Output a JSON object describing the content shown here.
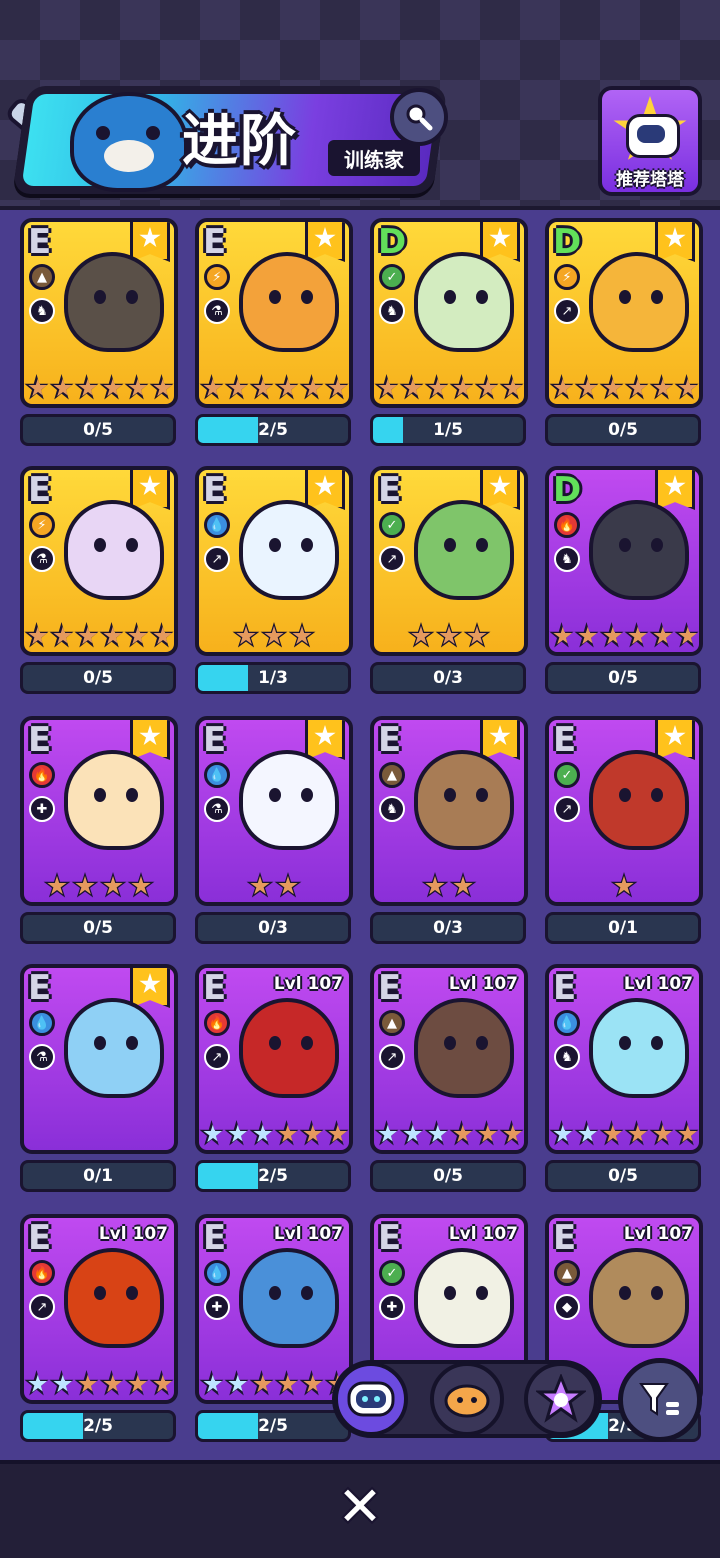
{
  "header": {
    "title": "进阶",
    "subtitle": "训练家",
    "recommend_label": "推荐塔塔"
  },
  "cards": [
    {
      "grade": "E",
      "grade_color": "#d4d4e6",
      "bg": "yellow",
      "type": "earth",
      "type_color": "#7a5a3a",
      "role": "foot",
      "badge": "star",
      "body": "#5a5048",
      "stars": [
        "b",
        "b",
        "b",
        "b",
        "b",
        "b"
      ],
      "progress": "0/5",
      "fill": 0
    },
    {
      "grade": "E",
      "grade_color": "#d4d4e6",
      "bg": "yellow",
      "type": "lightning",
      "type_color": "#f5a623",
      "role": "flask",
      "badge": "star",
      "body": "#f3a23a",
      "stars": [
        "b",
        "b",
        "b",
        "b",
        "b",
        "b"
      ],
      "progress": "2/5",
      "fill": 0.4
    },
    {
      "grade": "D",
      "grade_color": "#62e05a",
      "bg": "yellow",
      "type": "leaf",
      "type_color": "#4caf50",
      "role": "foot",
      "badge": "star",
      "body": "#d3ecc0",
      "stars": [
        "b",
        "b",
        "b",
        "b",
        "b",
        "b"
      ],
      "progress": "1/5",
      "fill": 0.2
    },
    {
      "grade": "D",
      "grade_color": "#62e05a",
      "bg": "yellow",
      "type": "lightning",
      "type_color": "#f5a623",
      "role": "run",
      "badge": "star",
      "body": "#f5b53a",
      "stars": [
        "b",
        "b",
        "b",
        "b",
        "b",
        "b"
      ],
      "progress": "0/5",
      "fill": 0
    },
    {
      "grade": "E",
      "grade_color": "#d4d4e6",
      "bg": "yellow",
      "type": "lightning",
      "type_color": "#f5a623",
      "role": "flask",
      "badge": "star",
      "body": "#e8d6f5",
      "stars": [
        "b",
        "b",
        "b",
        "b",
        "b",
        "b"
      ],
      "progress": "0/5",
      "fill": 0
    },
    {
      "grade": "E",
      "grade_color": "#d4d4e6",
      "bg": "yellow",
      "type": "water",
      "type_color": "#3b8fe0",
      "role": "run",
      "badge": "star",
      "body": "#eaf4ff",
      "stars": [
        "b",
        "b",
        "b"
      ],
      "progress": "1/3",
      "fill": 0.33
    },
    {
      "grade": "E",
      "grade_color": "#d4d4e6",
      "bg": "yellow",
      "type": "leaf",
      "type_color": "#4caf50",
      "role": "run",
      "badge": "star",
      "body": "#7fc56a",
      "stars": [
        "b",
        "b",
        "b"
      ],
      "progress": "0/3",
      "fill": 0
    },
    {
      "grade": "D",
      "grade_color": "#62e05a",
      "bg": "purple",
      "type": "fire",
      "type_color": "#e53935",
      "role": "foot",
      "badge": "star",
      "body": "#3a3a4a",
      "stars": [
        "b",
        "b",
        "b",
        "b",
        "b",
        "b"
      ],
      "progress": "0/5",
      "fill": 0
    },
    {
      "grade": "E",
      "grade_color": "#d4d4e6",
      "bg": "purple",
      "type": "fire",
      "type_color": "#e53935",
      "role": "plus",
      "badge": "star",
      "body": "#fbe2b8",
      "stars": [
        "b",
        "b",
        "b",
        "b"
      ],
      "progress": "0/5",
      "fill": 0
    },
    {
      "grade": "E",
      "grade_color": "#d4d4e6",
      "bg": "purple",
      "type": "water",
      "type_color": "#3b8fe0",
      "role": "flask",
      "badge": "star",
      "body": "#f4f6ff",
      "stars": [
        "b",
        "b"
      ],
      "progress": "0/3",
      "fill": 0
    },
    {
      "grade": "E",
      "grade_color": "#d4d4e6",
      "bg": "purple",
      "type": "earth",
      "type_color": "#7a5a3a",
      "role": "foot",
      "badge": "star",
      "body": "#a87c55",
      "stars": [
        "b",
        "b"
      ],
      "progress": "0/3",
      "fill": 0
    },
    {
      "grade": "E",
      "grade_color": "#d4d4e6",
      "bg": "purple",
      "type": "leaf",
      "type_color": "#4caf50",
      "role": "run",
      "badge": "star",
      "body": "#c0392b",
      "stars": [
        "b"
      ],
      "progress": "0/1",
      "fill": 0
    },
    {
      "grade": "E",
      "grade_color": "#d4d4e6",
      "bg": "purple",
      "type": "water",
      "type_color": "#3b8fe0",
      "role": "flask",
      "badge": "star",
      "body": "#8fd0f5",
      "stars": [],
      "progress": "0/1",
      "fill": 0
    },
    {
      "grade": "E",
      "grade_color": "#d4d4e6",
      "bg": "purple",
      "type": "fire",
      "type_color": "#e53935",
      "role": "run",
      "badge": "lvl",
      "level": "Lvl 107",
      "body": "#c62828",
      "stars": [
        "s",
        "s",
        "s",
        "b",
        "b",
        "b"
      ],
      "progress": "2/5",
      "fill": 0.4
    },
    {
      "grade": "E",
      "grade_color": "#d4d4e6",
      "bg": "purple",
      "type": "earth",
      "type_color": "#7a5a3a",
      "role": "run",
      "badge": "lvl",
      "level": "Lvl 107",
      "body": "#6d4c41",
      "stars": [
        "s",
        "s",
        "s",
        "b",
        "b",
        "b"
      ],
      "progress": "0/5",
      "fill": 0
    },
    {
      "grade": "E",
      "grade_color": "#d4d4e6",
      "bg": "purple",
      "type": "water",
      "type_color": "#3b8fe0",
      "role": "foot",
      "badge": "lvl",
      "level": "Lvl 107",
      "body": "#9be3f5",
      "stars": [
        "s",
        "s",
        "b",
        "b",
        "b",
        "b"
      ],
      "progress": "0/5",
      "fill": 0
    },
    {
      "grade": "E",
      "grade_color": "#d4d4e6",
      "bg": "purple",
      "type": "fire",
      "type_color": "#e53935",
      "role": "run",
      "badge": "lvl",
      "level": "Lvl 107",
      "body": "#d84315",
      "stars": [
        "s",
        "s",
        "b",
        "b",
        "b",
        "b"
      ],
      "progress": "2/5",
      "fill": 0.4
    },
    {
      "grade": "E",
      "grade_color": "#d4d4e6",
      "bg": "purple",
      "type": "water",
      "type_color": "#3b8fe0",
      "role": "plus",
      "badge": "lvl",
      "level": "Lvl 107",
      "body": "#4a90d9",
      "stars": [
        "s",
        "s",
        "b",
        "b",
        "b",
        "b"
      ],
      "progress": "2/5",
      "fill": 0.4
    },
    {
      "grade": "E",
      "grade_color": "#d4d4e6",
      "bg": "purple",
      "type": "leaf",
      "type_color": "#4caf50",
      "role": "plus",
      "badge": "lvl",
      "level": "Lvl 107",
      "body": "#f1f1e4",
      "stars": [],
      "progress": "",
      "fill": 0
    },
    {
      "grade": "E",
      "grade_color": "#d4d4e6",
      "bg": "purple",
      "type": "earth",
      "type_color": "#7a5a3a",
      "role": "shield",
      "badge": "lvl",
      "level": "Lvl 107",
      "body": "#b08b5c",
      "stars": [],
      "progress": "2/5",
      "fill": 0.4
    }
  ],
  "icons": {
    "search": "search-icon",
    "close": "close-icon",
    "filter": "filter-icon",
    "tabs": [
      "robot-icon",
      "cat-face-icon",
      "gem-star-icon"
    ]
  }
}
